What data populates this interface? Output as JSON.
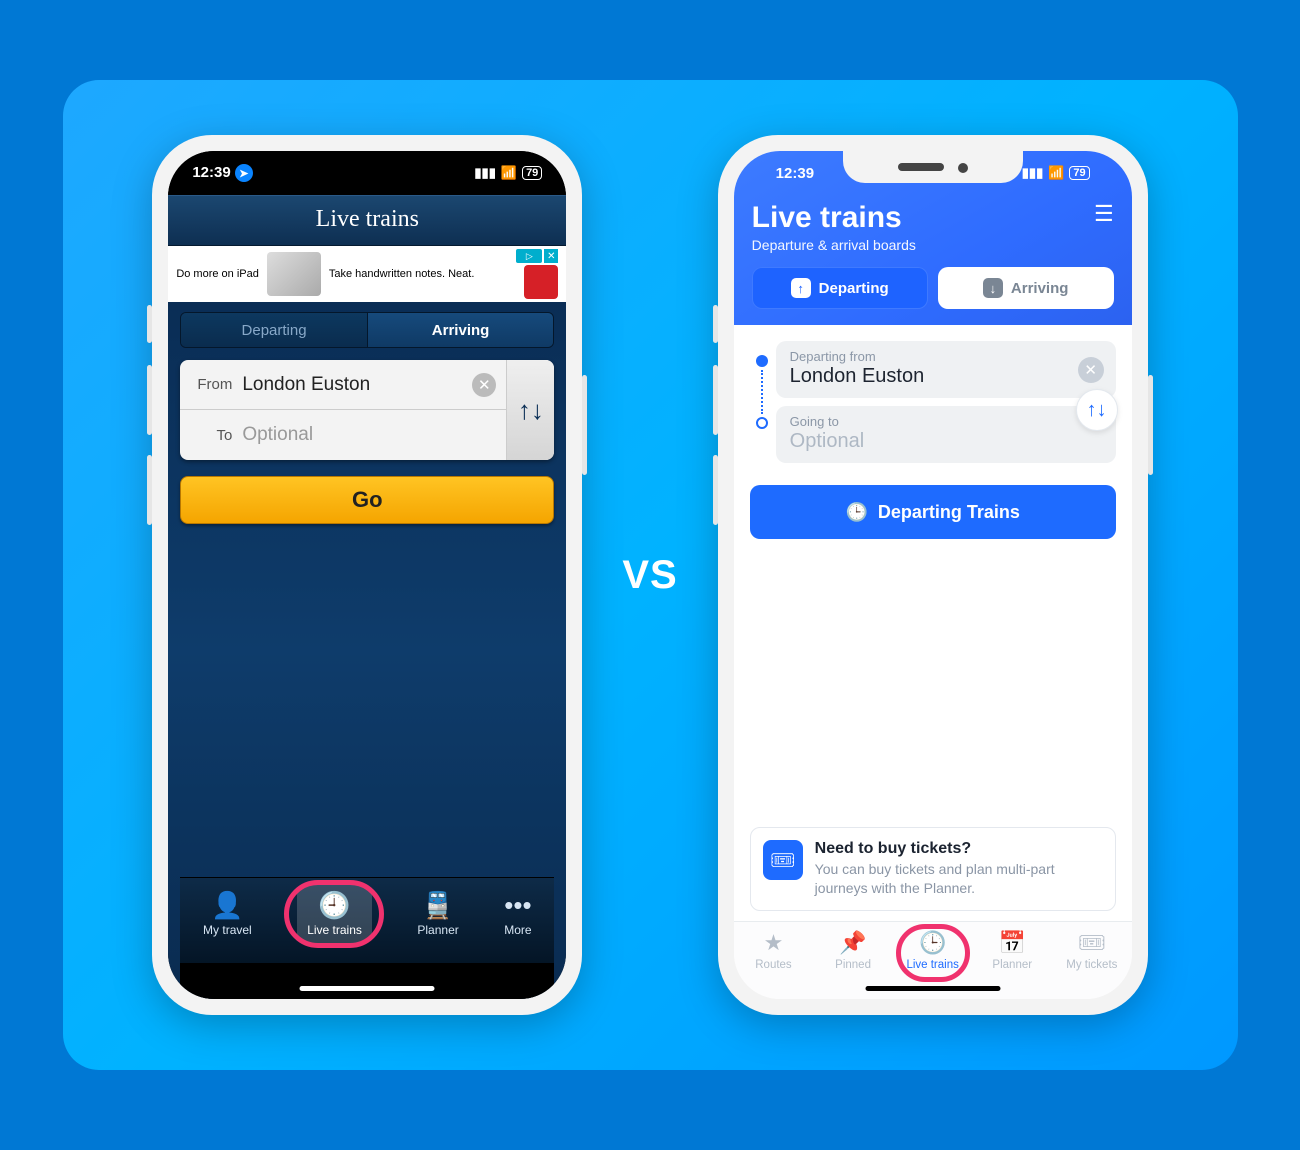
{
  "vs_label": "VS",
  "status": {
    "time": "12:39",
    "battery": "79"
  },
  "left": {
    "title": "Live trains",
    "ad": {
      "left": "Do more on iPad",
      "right": "Take handwritten notes. Neat."
    },
    "segments": {
      "departing": "Departing",
      "arriving": "Arriving"
    },
    "from_label": "From",
    "to_label": "To",
    "from_value": "London Euston",
    "to_placeholder": "Optional",
    "go": "Go",
    "tabs": [
      "My travel",
      "Live trains",
      "Planner",
      "More"
    ]
  },
  "right": {
    "title": "Live trains",
    "subtitle": "Departure & arrival boards",
    "segments": {
      "departing": "Departing",
      "arriving": "Arriving"
    },
    "from_label": "Departing from",
    "to_label": "Going to",
    "from_value": "London Euston",
    "to_placeholder": "Optional",
    "cta": "Departing Trains",
    "promo": {
      "title": "Need to buy tickets?",
      "text": "You can buy tickets and plan multi-part journeys with the Planner."
    },
    "tabs": [
      "Routes",
      "Pinned",
      "Live trains",
      "Planner",
      "My tickets"
    ]
  }
}
